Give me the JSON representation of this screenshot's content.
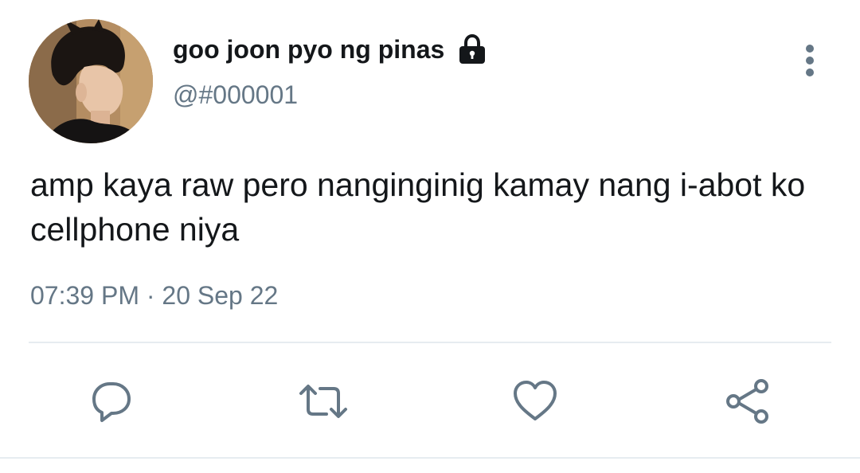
{
  "user": {
    "display_name": "goo joon pyo ng pinas",
    "handle": "@#000001",
    "avatar_icon": "profile-photo",
    "protected_icon": "lock-icon"
  },
  "tweet": {
    "text": "amp kaya raw pero nanginginig kamay nang i-abot ko cellphone niya",
    "time": "07:39 PM",
    "separator": "·",
    "date": "20 Sep 22"
  },
  "actions": [
    {
      "name": "reply",
      "icon": "reply-icon"
    },
    {
      "name": "retweet",
      "icon": "retweet-icon"
    },
    {
      "name": "like",
      "icon": "heart-icon"
    },
    {
      "name": "share",
      "icon": "share-icon"
    }
  ],
  "colors": {
    "text": "#14171a",
    "secondary": "#657786",
    "divider": "#e6ecf0"
  }
}
